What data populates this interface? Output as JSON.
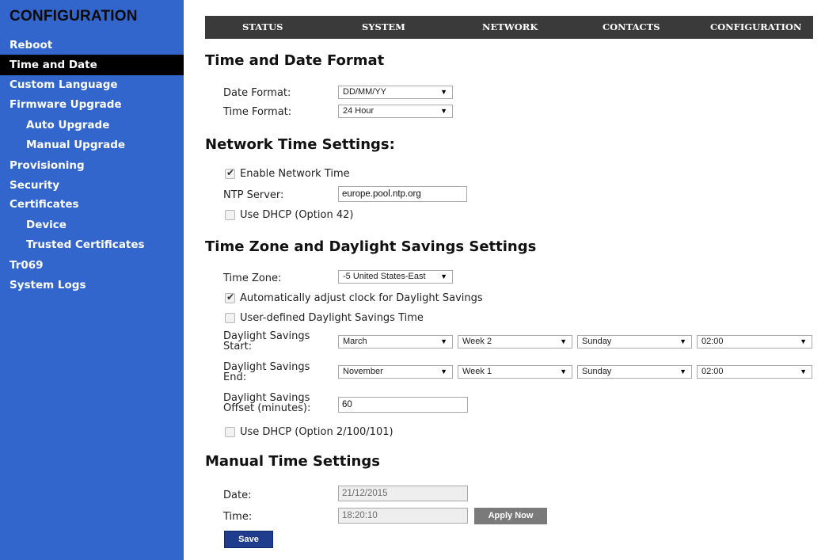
{
  "sidebar": {
    "title": "CONFIGURATION",
    "items": [
      {
        "label": "Reboot"
      },
      {
        "label": "Time and Date"
      },
      {
        "label": "Custom Language"
      },
      {
        "label": "Firmware Upgrade"
      },
      {
        "label": "Auto Upgrade"
      },
      {
        "label": "Manual Upgrade"
      },
      {
        "label": "Provisioning"
      },
      {
        "label": "Security"
      },
      {
        "label": "Certificates"
      },
      {
        "label": "Device"
      },
      {
        "label": "Trusted Certificates"
      },
      {
        "label": "Tr069"
      },
      {
        "label": "System Logs"
      }
    ]
  },
  "tabs": [
    "STATUS",
    "SYSTEM",
    "NETWORK",
    "CONTACTS",
    "CONFIGURATION"
  ],
  "format": {
    "title": "Time and Date Format",
    "date_label": "Date Format:",
    "date_value": "DD/MM/YY",
    "time_label": "Time Format:",
    "time_value": "24 Hour"
  },
  "ntp": {
    "title": "Network Time Settings:",
    "enable_label": "Enable Network Time",
    "enable_checked": true,
    "server_label": "NTP Server:",
    "server_value": "europe.pool.ntp.org",
    "dhcp_label": "Use DHCP (Option 42)",
    "dhcp_checked": false
  },
  "tz": {
    "title": "Time Zone and Daylight Savings Settings",
    "zone_label": "Time Zone:",
    "zone_value": "-5 United States-East",
    "auto_label": "Automatically adjust clock for Daylight Savings",
    "auto_checked": true,
    "user_label": "User-defined Daylight Savings Time",
    "user_checked": false,
    "start_label": "Daylight Savings Start:",
    "start": {
      "month": "March",
      "week": "Week 2",
      "day": "Sunday",
      "time": "02:00"
    },
    "end_label": "Daylight Savings End:",
    "end": {
      "month": "November",
      "week": "Week 1",
      "day": "Sunday",
      "time": "02:00"
    },
    "offset_label": "Daylight Savings Offset (minutes):",
    "offset_value": "60",
    "dhcp_label": "Use DHCP (Option 2/100/101)",
    "dhcp_checked": false
  },
  "manual": {
    "title": "Manual Time Settings",
    "date_label": "Date:",
    "date_value": "21/12/2015",
    "time_label": "Time:",
    "time_value": "18:20:10",
    "apply_label": "Apply Now"
  },
  "save_label": "Save",
  "icons": {
    "dropdown": "caret-down-icon",
    "check": "checkmark-icon"
  },
  "colors": {
    "sidebar": "#3366cc",
    "active": "#000000",
    "topnav": "#3a3a3a",
    "save": "#1f3d8c"
  }
}
